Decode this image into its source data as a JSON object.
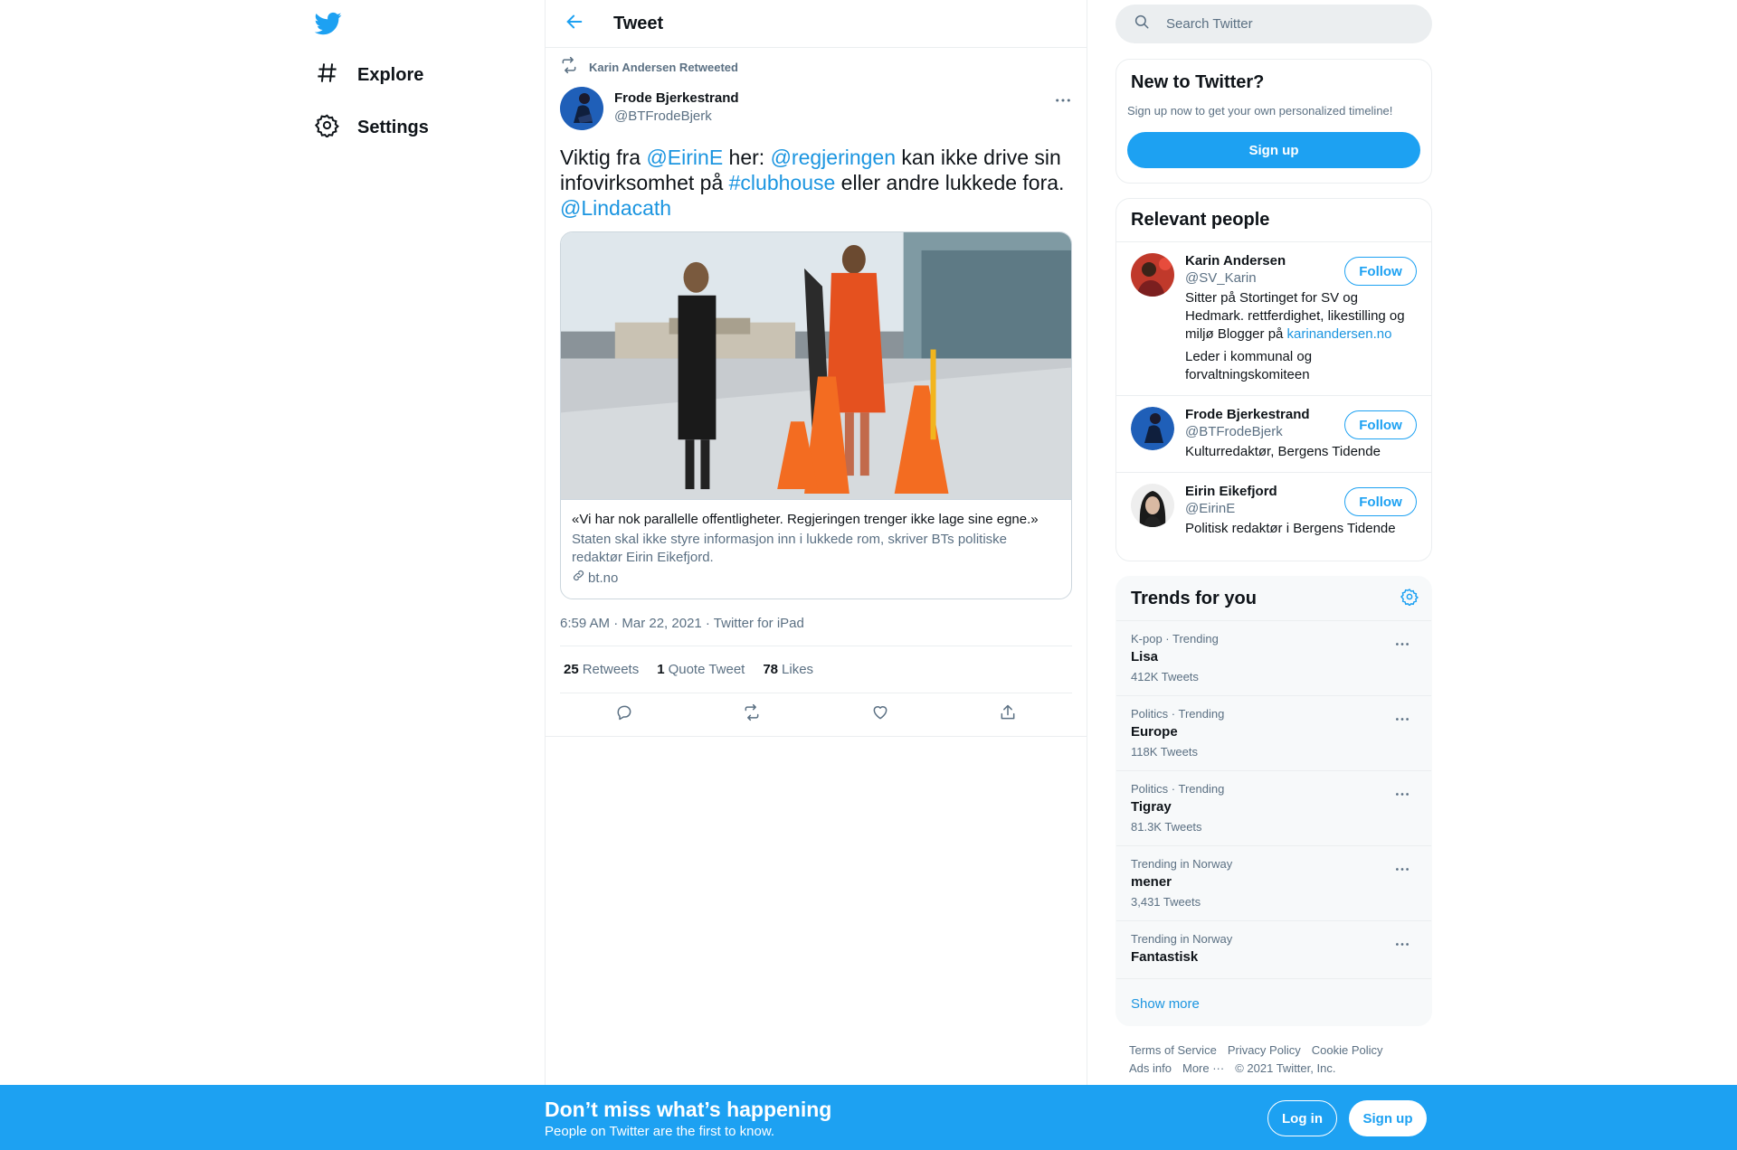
{
  "nav": {
    "items": [
      {
        "label": "Explore",
        "icon": "hashtag-icon"
      },
      {
        "label": "Settings",
        "icon": "gear-icon"
      }
    ]
  },
  "header": {
    "title": "Tweet"
  },
  "tweet": {
    "retweet_line": "Karin Andersen Retweeted",
    "author_name": "Frode Bjerkestrand",
    "author_handle": "@BTFrodeBjerk",
    "text_parts": {
      "p1": "Viktig fra ",
      "m1": "@EirinE",
      "p2": " her: ",
      "m2": "@regjeringen",
      "p3": " kan ikke drive sin infovirksomhet på ",
      "h1": "#clubhouse",
      "p4": " eller andre lukkede fora. ",
      "m3": "@Lindacath"
    },
    "card": {
      "title": "«Vi har nok parallelle offentligheter. Regjeringen trenger ikke lage sine egne.»",
      "description": "Staten skal ikke styre informasjon inn i lukkede rom, skriver BTs politiske redaktør Eirin Eikefjord.",
      "domain": "bt.no"
    },
    "timestamp": "6:59 AM · Mar 22, 2021 · Twitter for iPad",
    "counts": {
      "retweets_num": "25",
      "retweets_label": "Retweets",
      "quotes_num": "1",
      "quotes_label": "Quote Tweet",
      "likes_num": "78",
      "likes_label": "Likes"
    }
  },
  "search": {
    "placeholder": "Search Twitter"
  },
  "new_to_twitter": {
    "title": "New to Twitter?",
    "subtitle": "Sign up now to get your own personalized timeline!",
    "button": "Sign up"
  },
  "relevant_people": {
    "title": "Relevant people",
    "follow_label": "Follow",
    "people": [
      {
        "name": "Karin Andersen",
        "handle": "@SV_Karin",
        "bio_text": "Sitter på Stortinget for SV og Hedmark. rettferdighet, likestilling og miljø Blogger på ",
        "bio_link": "karinandersen.no",
        "bio2": "Leder i kommunal og forvaltningskomiteen"
      },
      {
        "name": "Frode Bjerkestrand",
        "handle": "@BTFrodeBjerk",
        "bio_text": "Kulturredaktør, Bergens Tidende"
      },
      {
        "name": "Eirin Eikefjord",
        "handle": "@EirinE",
        "bio_text": "Politisk redaktør i Bergens Tidende"
      }
    ]
  },
  "trends": {
    "title": "Trends for you",
    "items": [
      {
        "context": "K-pop · Trending",
        "name": "Lisa",
        "count": "412K Tweets"
      },
      {
        "context": "Politics · Trending",
        "name": "Europe",
        "count": "118K Tweets"
      },
      {
        "context": "Politics · Trending",
        "name": "Tigray",
        "count": "81.3K Tweets"
      },
      {
        "context": "Trending in Norway",
        "name": "mener",
        "count": "3,431 Tweets"
      },
      {
        "context": "Trending in Norway",
        "name": "Fantastisk",
        "count": ""
      }
    ],
    "show_more": "Show more"
  },
  "footer": {
    "links": [
      "Terms of Service",
      "Privacy Policy",
      "Cookie Policy",
      "Ads info",
      "More ···",
      "© 2021 Twitter, Inc."
    ]
  },
  "bottom_bar": {
    "title": "Don’t miss what’s happening",
    "subtitle": "People on Twitter are the first to know.",
    "login": "Log in",
    "signup": "Sign up"
  },
  "colors": {
    "accent": "#1da1f2",
    "link": "#1b95e0",
    "muted": "#5b7083",
    "border": "#ebeef0"
  }
}
